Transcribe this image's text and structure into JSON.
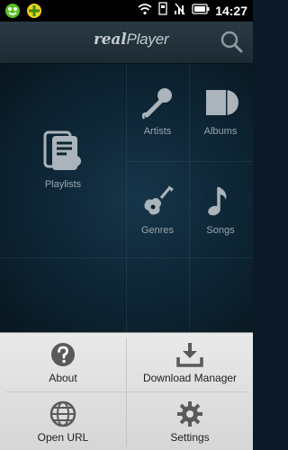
{
  "status_bar": {
    "time": "14:27",
    "icons": [
      "app-notify-icon",
      "app-notify-icon-2",
      "wifi-icon",
      "sd-card-icon",
      "no-signal-icon",
      "battery-icon"
    ]
  },
  "header": {
    "logo_part1": "real",
    "logo_part2": "Player",
    "search_icon": "search-icon"
  },
  "tiles": {
    "playlists": "Playlists",
    "artists": "Artists",
    "albums": "Albums",
    "genres": "Genres",
    "songs": "Songs"
  },
  "menu": {
    "about": "About",
    "download_manager": "Download Manager",
    "open_url": "Open URL",
    "settings": "Settings"
  },
  "colors": {
    "accent_green": "#5bbf2a",
    "accent_yellow": "#f1d21b",
    "tile_icon": "#aab4ba",
    "menu_icon": "#555555"
  }
}
